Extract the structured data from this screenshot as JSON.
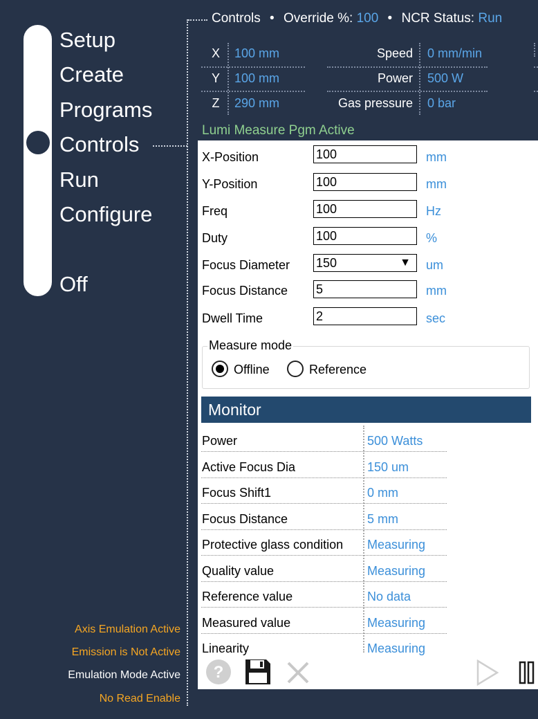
{
  "colors": {
    "background": "#263348",
    "accent_value": "#5aa6e8",
    "active_status": "#8fd08f",
    "warning": "#f5a623",
    "monitor_header": "#23496e"
  },
  "nav": {
    "items": [
      {
        "label": "Setup"
      },
      {
        "label": "Create"
      },
      {
        "label": "Programs"
      },
      {
        "label": "Controls",
        "selected": true
      },
      {
        "label": "Run"
      },
      {
        "label": "Configure"
      },
      {
        "label": "Off"
      }
    ]
  },
  "header": {
    "controls_label": "Controls",
    "override_label": "Override %:",
    "override_value": "100",
    "ncr_label": "NCR Status:",
    "ncr_value": "Run"
  },
  "axes": [
    {
      "label": "X",
      "value": "100 mm"
    },
    {
      "label": "Y",
      "value": "100 mm"
    },
    {
      "label": "Z",
      "value": "290 mm"
    }
  ],
  "params": [
    {
      "label": "Speed",
      "value": "0 mm/min"
    },
    {
      "label": "Power",
      "value": "500 W"
    },
    {
      "label": "Gas pressure",
      "value": "0 bar"
    }
  ],
  "program_status": "Lumi Measure Pgm Active",
  "form": {
    "fields": [
      {
        "label": "X-Position",
        "value": "100",
        "unit": "mm"
      },
      {
        "label": "Y-Position",
        "value": "100",
        "unit": "mm"
      },
      {
        "label": "Freq",
        "value": "100",
        "unit": "Hz"
      },
      {
        "label": "Duty",
        "value": "100",
        "unit": "%"
      },
      {
        "label": "Focus Diameter",
        "value": "150",
        "unit": "um",
        "type": "select"
      },
      {
        "label": "Focus Distance",
        "value": "5",
        "unit": "mm"
      },
      {
        "label": "Dwell Time",
        "value": "2",
        "unit": "sec"
      }
    ],
    "measure_mode": {
      "title": "Measure mode",
      "options": [
        {
          "label": "Offline",
          "selected": true
        },
        {
          "label": "Reference",
          "selected": false
        }
      ]
    }
  },
  "monitor": {
    "title": "Monitor",
    "rows": [
      {
        "label": "Power",
        "value": "500 Watts"
      },
      {
        "label": "Active Focus Dia",
        "value": "150 um"
      },
      {
        "label": "Focus Shift1",
        "value": "0 mm"
      },
      {
        "label": "Focus Distance",
        "value": "5 mm"
      },
      {
        "label": "Protective glass condition",
        "value": "Measuring"
      },
      {
        "label": "Quality value",
        "value": "Measuring"
      },
      {
        "label": "Reference value",
        "value": "No data"
      },
      {
        "label": "Measured value",
        "value": "Measuring"
      },
      {
        "label": "Linearity",
        "value": "Measuring"
      }
    ]
  },
  "toolbar": {
    "help_icon": "help-icon",
    "save_icon": "save-icon",
    "cancel_icon": "close-icon",
    "play_icon": "play-icon",
    "pause_icon": "pause-icon"
  },
  "status": [
    {
      "text": "Axis Emulation Active",
      "color": "#f5a623"
    },
    {
      "text": "Emission is Not Active",
      "color": "#f5a623"
    },
    {
      "text": "Emulation Mode Active",
      "color": "#ffffff"
    },
    {
      "text": "No Read Enable",
      "color": "#f5a623"
    }
  ]
}
